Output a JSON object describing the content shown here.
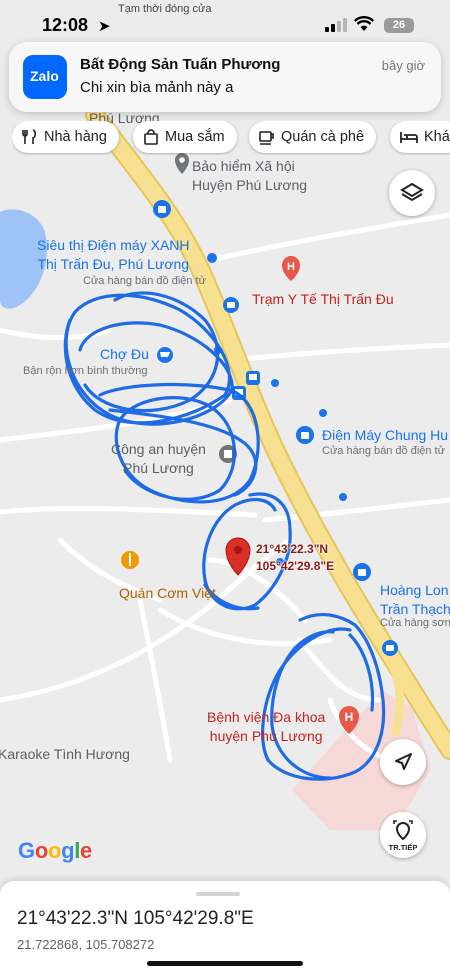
{
  "status_bar": {
    "time": "12:08",
    "battery": "26"
  },
  "notification": {
    "app_icon_label": "Zalo",
    "title": "Bất Động Sản Tuấn Phương",
    "body": "Chi xin bìa mảnh này a",
    "time": "bây giờ",
    "peek_text": "Tạm thời đóng cửa",
    "peek_label": "Phú Lương"
  },
  "chips": [
    {
      "label": "Nhà hàng",
      "icon": "fork-knife-icon"
    },
    {
      "label": "Mua sắm",
      "icon": "shopping-bag-icon"
    },
    {
      "label": "Quán cà phê",
      "icon": "coffee-cup-icon"
    },
    {
      "label": "Khá",
      "icon": "bed-icon"
    }
  ],
  "map": {
    "labels": {
      "phu_luong_top": "Phú Lương",
      "bao_hiem": "Bảo hiểm Xã hội\nHuyện Phú Lương",
      "sieu_thi": "Siêu thị Điện máy XANH\nThị Trấn Đu, Phú Lương",
      "sieu_thi_sub": "Cửa hàng bán đồ điện tử",
      "tram_yte": "Trạm Y Tế Thị Trấn Đu",
      "cho_du": "Chợ Đu",
      "cho_du_sub": "Bận rộn hơn bình thường",
      "cong_an": "Công an huyện\nPhú Lương",
      "dien_may": "Điện Máy Chung Hu",
      "dien_may_sub": "Cửa hàng bán đồ điện tử",
      "quan_com": "Quán Cơm Việt",
      "hoang_long": "Hoàng Lon\nTrần Thạch",
      "hoang_long_sub": "Cửa hàng sơn",
      "benh_vien": "Bệnh viện Đa khoa\nhuyện Phú Lương",
      "karaoke": "Karaoke Tình Hương"
    },
    "dropped_pin_label": "21°43'22.3\"N\n105°42'29.8\"E",
    "google_logo": "Google",
    "layers_icon": "layers-icon",
    "navigate_icon": "navigation-arrow-icon",
    "tr_tiep_label": "TR.TIẾP"
  },
  "bottom_sheet": {
    "dms": "21°43'22.3\"N 105°42'29.8\"E",
    "decimal": "21.722868, 105.708272"
  },
  "colors": {
    "map_bg": "#ececec",
    "road_major": "#f7e08f",
    "road_major_edge": "#e6c65c",
    "scribble": "#1565e6",
    "pin": "#d93025",
    "shop_blue": "#1a73e8",
    "zalo_blue": "#0068ff"
  }
}
